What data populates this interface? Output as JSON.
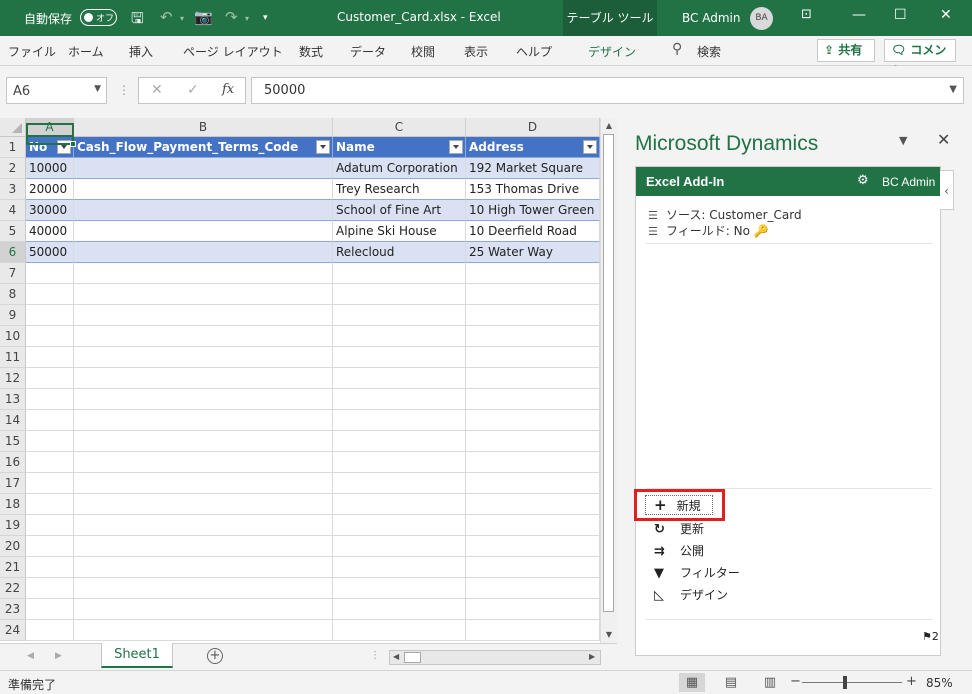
{
  "titlebar": {
    "autosave_label": "自動保存",
    "autosave_state": "オフ",
    "document": "Customer_Card.xlsx  -  Excel",
    "tool_tab": "テーブル ツール",
    "user": "BC Admin",
    "avatar_initials": "BA"
  },
  "ribbon": {
    "tabs": [
      "ファイル",
      "ホーム",
      "挿入",
      "ページ レイアウト",
      "数式",
      "データ",
      "校閲",
      "表示",
      "ヘルプ",
      "デザイン"
    ],
    "search_label": "検索",
    "share_label": "共有",
    "comment_label": "コメント"
  },
  "formula_bar": {
    "name_box": "A6",
    "fx": "fx",
    "value": "50000"
  },
  "grid": {
    "columns": [
      "A",
      "B",
      "C",
      "D"
    ],
    "selected_column": "A",
    "headers": [
      "No",
      "Cash_Flow_Payment_Terms_Code",
      "Name",
      "Address"
    ],
    "rows": [
      [
        "10000",
        "",
        "Adatum Corporation",
        "192 Market Square"
      ],
      [
        "20000",
        "",
        "Trey Research",
        "153 Thomas Drive"
      ],
      [
        "30000",
        "",
        "School of Fine Art",
        "10 High Tower Green"
      ],
      [
        "40000",
        "",
        "Alpine Ski House",
        "10 Deerfield Road"
      ],
      [
        "50000",
        "",
        "Relecloud",
        "25 Water Way"
      ]
    ],
    "row_numbers": [
      "1",
      "2",
      "3",
      "4",
      "5",
      "6",
      "7",
      "8",
      "9",
      "10",
      "11",
      "12",
      "13",
      "14",
      "15",
      "16",
      "17",
      "18",
      "19",
      "20",
      "21",
      "22",
      "23",
      "24"
    ],
    "selected_row": "6"
  },
  "sheets": {
    "active": "Sheet1"
  },
  "status": {
    "ready": "準備完了",
    "zoom": "85%"
  },
  "pane": {
    "title": "Microsoft Dynamics",
    "addin_title": "Excel Add-In",
    "addin_user": "BC Admin",
    "source_label": "ソース: Customer_Card",
    "field_label": "フィールド: No",
    "actions": {
      "new": "新規",
      "refresh": "更新",
      "publish": "公開",
      "filter": "フィルター",
      "design": "デザイン"
    },
    "page_count": "2"
  }
}
